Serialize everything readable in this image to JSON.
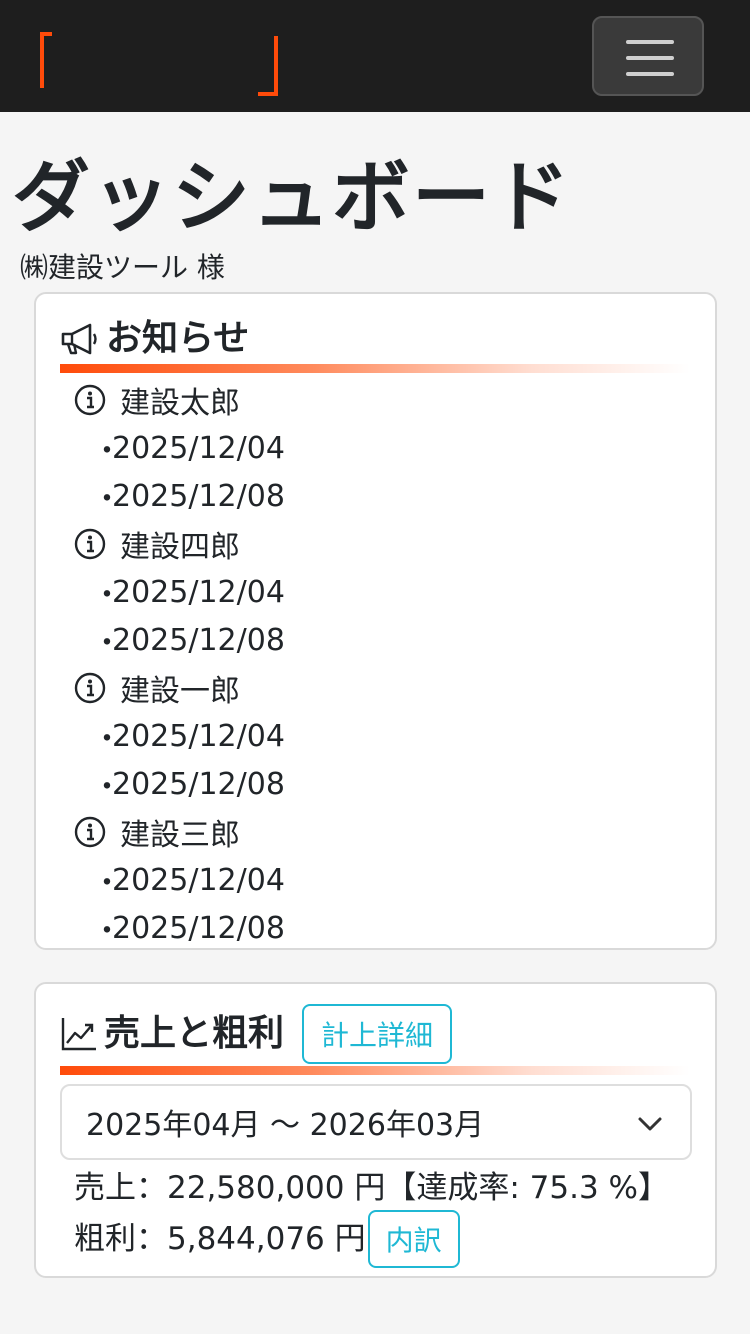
{
  "colors": {
    "navbar_bg": "#1e1e1e",
    "accent": "#ff4b0a",
    "button_outline": "#1fb8d4"
  },
  "header": {
    "brand_icon": "bracket-logo",
    "menu_icon": "hamburger-icon"
  },
  "page": {
    "title": "ダッシュボード",
    "customer": "㈱建設ツール 様"
  },
  "news": {
    "icon": "megaphone-icon",
    "title": "お知らせ",
    "items": [
      {
        "name": "建設太郎",
        "dates": [
          "2025/12/04",
          "2025/12/08"
        ]
      },
      {
        "name": "建設四郎",
        "dates": [
          "2025/12/04",
          "2025/12/08"
        ]
      },
      {
        "name": "建設一郎",
        "dates": [
          "2025/12/04",
          "2025/12/08"
        ]
      },
      {
        "name": "建設三郎",
        "dates": [
          "2025/12/04",
          "2025/12/08"
        ]
      }
    ],
    "date_bullet": "・"
  },
  "sales": {
    "icon": "chart-line-icon",
    "title": "売上と粗利",
    "detail_button": "計上詳細",
    "period_selected": "2025年04月 ～ 2026年03月",
    "sales_text": "売上：22,580,000 円【達成率: 75.3 %】",
    "profit_text": "粗利：5,844,076 円",
    "breakdown_button": "内訳"
  }
}
